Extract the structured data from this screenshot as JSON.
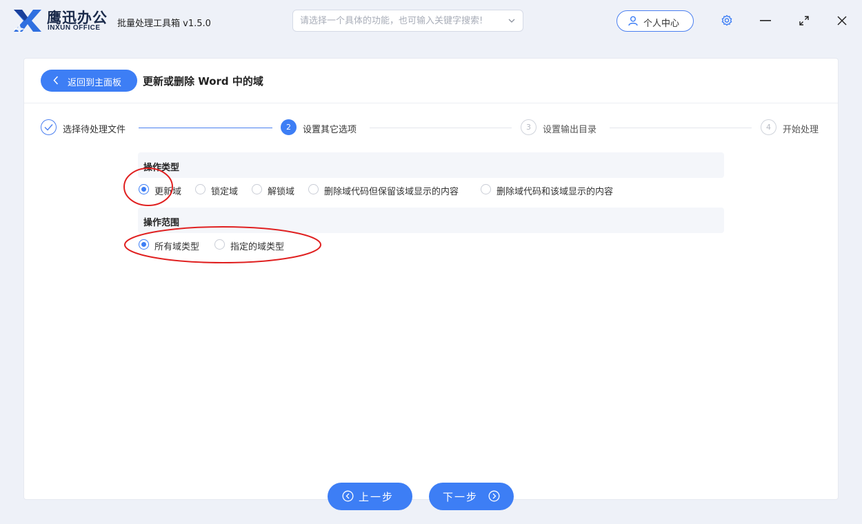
{
  "app": {
    "brand_cn": "鹰迅办公",
    "brand_en": "INXUN OFFICE",
    "title": "批量处理工具箱 v1.5.0"
  },
  "search": {
    "placeholder": "请选择一个具体的功能，也可输入关键字搜索!"
  },
  "header": {
    "user_center_label": "个人中心"
  },
  "page": {
    "back_label": "返回到主面板",
    "title": "更新或删除 Word 中的域"
  },
  "steps": [
    {
      "number": "1",
      "label": "选择待处理文件",
      "state": "done"
    },
    {
      "number": "2",
      "label": "设置其它选项",
      "state": "active"
    },
    {
      "number": "3",
      "label": "设置输出目录",
      "state": "todo"
    },
    {
      "number": "4",
      "label": "开始处理",
      "state": "todo"
    }
  ],
  "operation_type": {
    "heading": "操作类型",
    "options": [
      {
        "label": "更新域",
        "selected": true
      },
      {
        "label": "锁定域",
        "selected": false
      },
      {
        "label": "解锁域",
        "selected": false
      },
      {
        "label": "删除域代码但保留该域显示的内容",
        "selected": false
      },
      {
        "label": "删除域代码和该域显示的内容",
        "selected": false
      }
    ]
  },
  "operation_scope": {
    "heading": "操作范围",
    "options": [
      {
        "label": "所有域类型",
        "selected": true
      },
      {
        "label": "指定的域类型",
        "selected": false
      }
    ]
  },
  "footer": {
    "prev_label": "上一步",
    "next_label": "下一步"
  },
  "colors": {
    "accent": "#3d7ef5",
    "annotation": "#e02020",
    "background": "#eef1f8"
  }
}
